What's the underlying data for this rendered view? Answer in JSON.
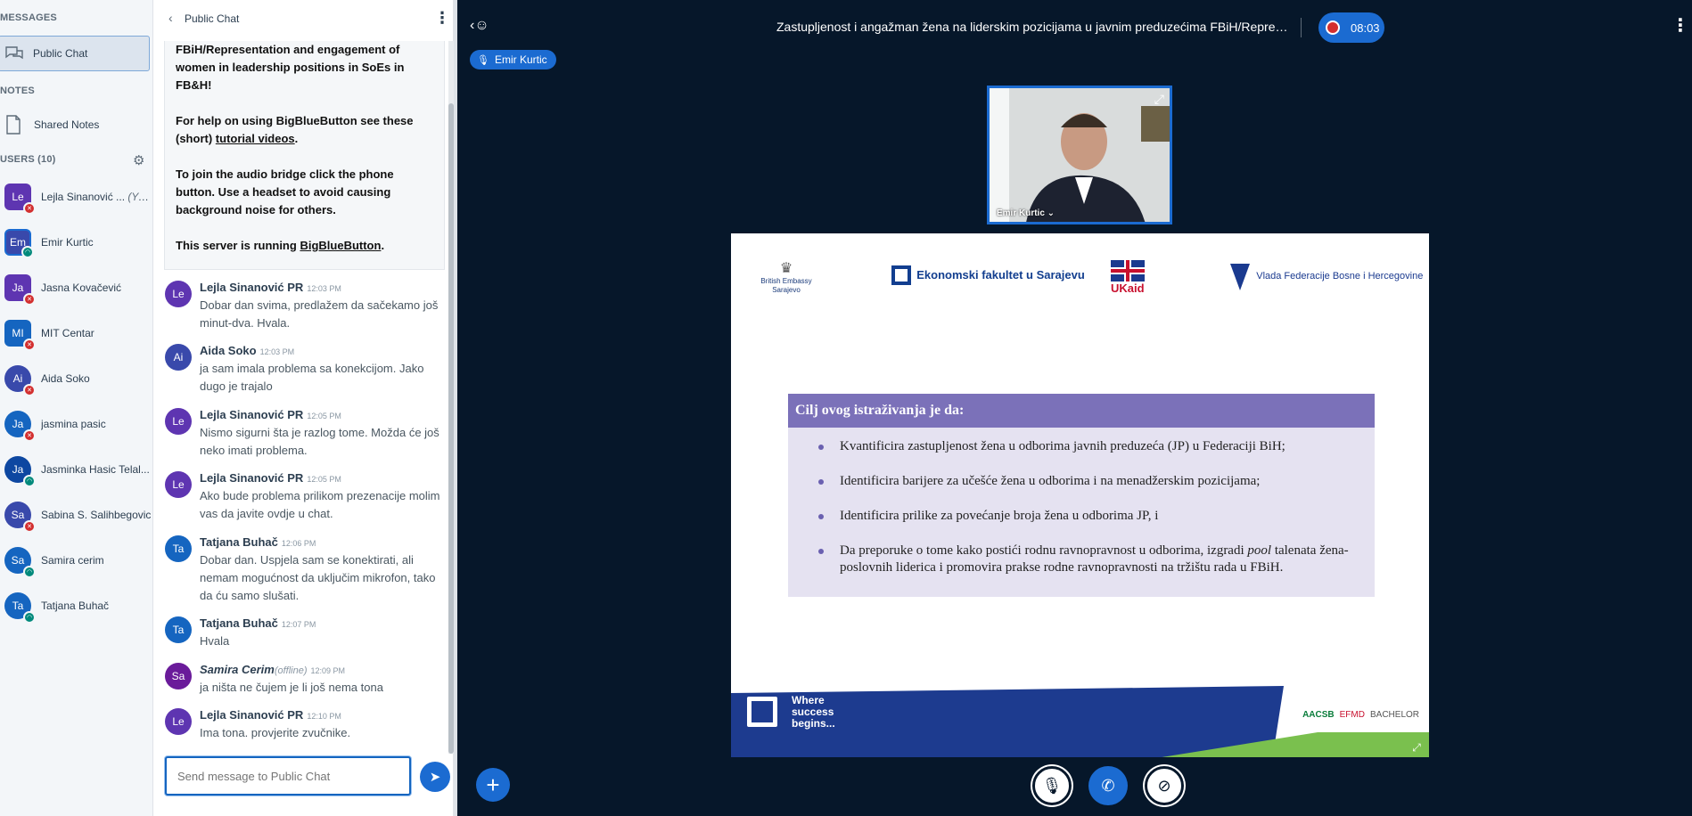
{
  "sidebar": {
    "messages_title": "MESSAGES",
    "public_chat": "Public Chat",
    "notes_title": "NOTES",
    "shared_notes": "Shared Notes",
    "users_title": "USERS (10)"
  },
  "users": [
    {
      "initials": "Le",
      "name": "Lejla Sinanović ...",
      "suffix": "(You)",
      "status": "muted"
    },
    {
      "initials": "Em",
      "name": "Emir Kurtic",
      "status": "listening"
    },
    {
      "initials": "Ja",
      "name": "Jasna Kovačević",
      "status": "muted"
    },
    {
      "initials": "MI",
      "name": "MIT Centar",
      "status": "muted"
    },
    {
      "initials": "Ai",
      "name": "Aida Soko",
      "status": "muted"
    },
    {
      "initials": "Ja",
      "name": "jasmina pasic",
      "status": "muted"
    },
    {
      "initials": "Ja",
      "name": "Jasminka Hasic Telal...",
      "status": "listening"
    },
    {
      "initials": "Sa",
      "name": "Sabina S. Salihbegovic",
      "status": "muted"
    },
    {
      "initials": "Sa",
      "name": "Samira cerim",
      "status": "listening"
    },
    {
      "initials": "Ta",
      "name": "Tatjana Buhač",
      "status": "listening"
    }
  ],
  "chat": {
    "title": "Public Chat",
    "welcome": [
      "FBiH/Representation and engagement of women in leadership positions in SoEs in FB&H!",
      "For help on using BigBlueButton see these (short)",
      "To join the audio bridge click the phone button. Use a headset to avoid causing background noise for others.",
      "This server is running"
    ],
    "welcome_link1": "tutorial videos",
    "welcome_link2": "BigBlueButton",
    "messages": [
      {
        "initials": "Le",
        "author": "Lejla Sinanović PR",
        "time": "12:03 PM",
        "text": "Dobar dan svima, predlažem da sačekamo još minut-dva. Hvala."
      },
      {
        "initials": "Ai",
        "author": "Aida Soko",
        "time": "12:03 PM",
        "text": "ja sam imala problema sa konekcijom. Jako dugo je trajalo"
      },
      {
        "initials": "Le",
        "author": "Lejla Sinanović PR",
        "time": "12:05 PM",
        "text": "Nismo sigurni šta je razlog tome. Možda će još neko imati problema."
      },
      {
        "initials": "Le",
        "author": "Lejla Sinanović PR",
        "time": "12:05 PM",
        "text": "Ako bude problema prilikom prezenacije molim vas da javite ovdje u chat."
      },
      {
        "initials": "Ta",
        "author": "Tatjana Buhač",
        "time": "12:06 PM",
        "text": "Dobar dan. Uspjela sam se konektirati, ali nemam mogućnost da uključim mikrofon, tako da ću samo slušati."
      },
      {
        "initials": "Ta",
        "author": "Tatjana Buhač",
        "time": "12:07 PM",
        "text": "Hvala"
      },
      {
        "initials": "Sa",
        "author": "Samira Cerim",
        "status": "(offline)",
        "time": "12:09 PM",
        "text": "ja ništa ne čujem je li još nema tona"
      },
      {
        "initials": "Le",
        "author": "Lejla Sinanović PR",
        "time": "12:10 PM",
        "text": "Ima tona. provjerite zvučnike."
      }
    ],
    "input_placeholder": "Send message to Public Chat"
  },
  "meeting": {
    "title": "Zastupljenost i angažman žena na liderskim pozicijama u javnim preduzećima FBiH/Representation ...",
    "rec_time": "08:03",
    "talker": "Emir Kurtic",
    "webcam_name": "Emir Kurtic ⌄"
  },
  "slide": {
    "logo1": "British Embassy Sarajevo",
    "logo2": "Ekonomski fakultet u Sarajevu",
    "logo3": "UKaid",
    "logo4": "Vlada Federacije Bosne i Hercegovine",
    "heading": "Cilj ovog istraživanja je da:",
    "bullets": [
      "Kvantificira zastupljenost žena u odborima javnih preduzeća (JP) u Federaciji BiH;",
      "Identificira barijere za učešće žena u odborima i na menadžerskim pozicijama;",
      "Identificira prilike za povećanje broja žena u odborima JP, i"
    ],
    "bullet4_a": "Da preporuke o tome kako postići rodnu ravnopravnost u odborima, izgradi",
    "bullet4_pool": "pool",
    "bullet4_b": "talenata žena-poslovnih liderica i promovira prakse rodne ravnopravnosti na tržištu rada u FBiH.",
    "slogan": [
      "Where",
      "success",
      "begins..."
    ],
    "badge1": "AACSB",
    "badge2": "EFMD",
    "badge3": "BACHELOR"
  }
}
